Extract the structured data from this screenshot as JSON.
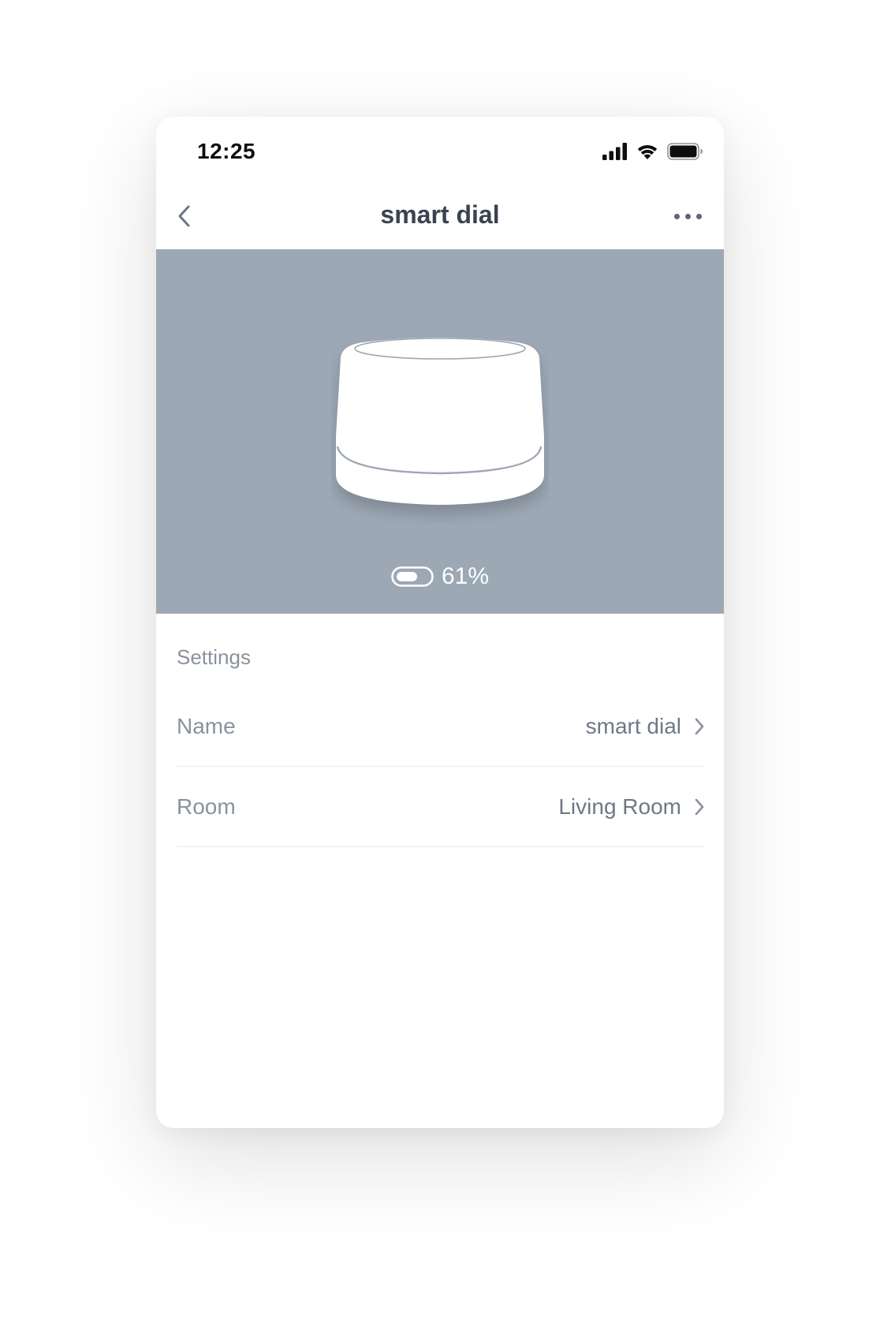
{
  "status_bar": {
    "time": "12:25",
    "icons": [
      "cellular-signal-icon",
      "wifi-icon",
      "battery-icon"
    ]
  },
  "nav": {
    "title": "smart dial",
    "back_icon": "chevron-left-icon",
    "more_icon": "more-horizontal-icon"
  },
  "device": {
    "image": "smart-dial-device-illustration",
    "battery_icon": "battery-icon",
    "battery_level": "61%"
  },
  "settings": {
    "title": "Settings",
    "rows": [
      {
        "label": "Name",
        "value": "smart dial"
      },
      {
        "label": "Room",
        "value": "Living Room"
      }
    ]
  },
  "colors": {
    "hero_background": "#9da8b5",
    "title_text": "#3a4350",
    "muted_text": "#8a929d",
    "value_text": "#6f7885",
    "divider": "#e4e7eb"
  }
}
